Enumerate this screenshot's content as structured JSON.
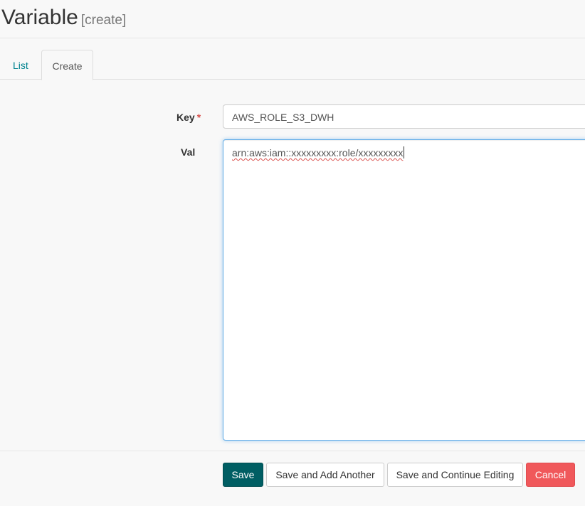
{
  "header": {
    "title": "Variable",
    "subtitle": "[create]"
  },
  "tabs": [
    {
      "label": "List",
      "active": false
    },
    {
      "label": "Create",
      "active": true
    }
  ],
  "form": {
    "key": {
      "label": "Key",
      "required_marker": "*",
      "value": "AWS_ROLE_S3_DWH"
    },
    "val": {
      "label": "Val",
      "value": "arn:aws:iam::xxxxxxxxx:role/xxxxxxxxx"
    }
  },
  "buttons": {
    "save": "Save",
    "save_add_another": "Save and Add Another",
    "save_continue": "Save and Continue Editing",
    "cancel": "Cancel"
  },
  "colors": {
    "primary": "#005e63",
    "danger": "#f0585b",
    "link": "#00838f"
  }
}
